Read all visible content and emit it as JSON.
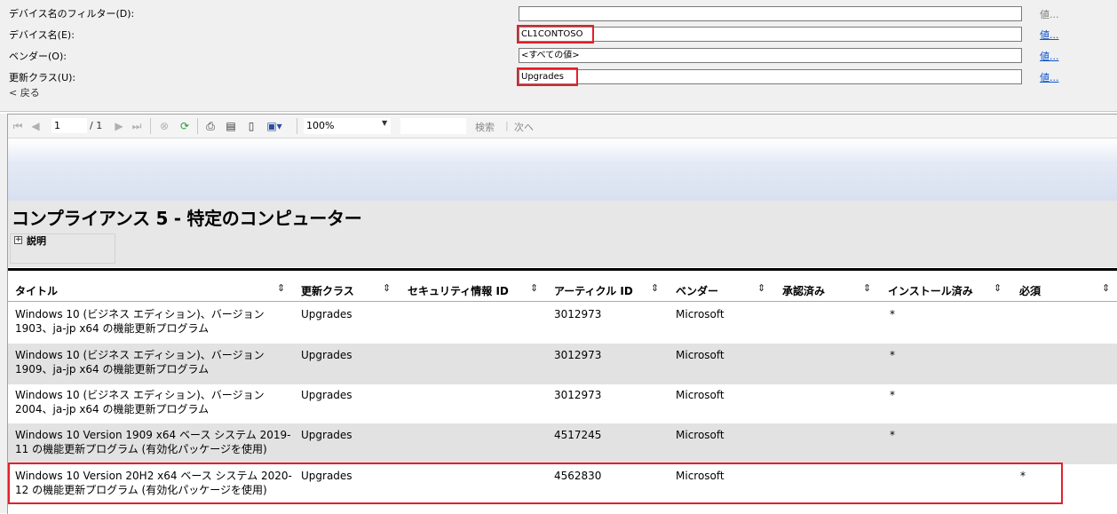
{
  "parameters": {
    "device_filter": {
      "label": "デバイス名のフィルター(D):",
      "value": "",
      "link": "値..."
    },
    "device_name": {
      "label": "デバイス名(E):",
      "value": "CL1CONTOSO",
      "link": "値..."
    },
    "vendor": {
      "label": "ベンダー(O):",
      "value": "<すべての値>",
      "link": "値..."
    },
    "update_class": {
      "label": "更新クラス(U):",
      "value": "Upgrades",
      "link": "値..."
    },
    "back": "< 戻る"
  },
  "toolbar": {
    "page_current": "1",
    "page_total": "/ 1",
    "zoom": "100%",
    "find": "検索",
    "separator": "|",
    "next": "次へ",
    "icons": [
      "first-page-icon",
      "prev-page-icon",
      "next-page-icon",
      "last-page-icon",
      "stop-icon",
      "refresh-icon",
      "print-icon",
      "print-layout-icon",
      "page-setup-icon",
      "export-icon"
    ]
  },
  "report": {
    "title": "コンプライアンス 5 - 特定のコンピューター",
    "description_label": "説明",
    "expand_glyph": "+"
  },
  "table": {
    "sort_glyph": "⇕",
    "columns": [
      "タイトル",
      "更新クラス",
      "セキュリティ情報 ID",
      "アーティクル ID",
      "ベンダー",
      "承認済み",
      "インストール済み",
      "必須"
    ],
    "rows": [
      {
        "title_line1": "Windows 10 (ビジネス エディション)、バージョン",
        "title_line2": "1903、ja-jp x64 の機能更新プログラム",
        "class": "Upgrades",
        "bulletin": "",
        "article": "3012973",
        "vendor": "Microsoft",
        "approved": "",
        "installed": "*",
        "required": ""
      },
      {
        "title_line1": "Windows 10 (ビジネス エディション)、バージョン",
        "title_line2": "1909、ja-jp x64 の機能更新プログラム",
        "class": "Upgrades",
        "bulletin": "",
        "article": "3012973",
        "vendor": "Microsoft",
        "approved": "",
        "installed": "*",
        "required": ""
      },
      {
        "title_line1": "Windows 10 (ビジネス エディション)、バージョン",
        "title_line2": "2004、ja-jp x64 の機能更新プログラム",
        "class": "Upgrades",
        "bulletin": "",
        "article": "3012973",
        "vendor": "Microsoft",
        "approved": "",
        "installed": "*",
        "required": ""
      },
      {
        "title_line1": "Windows 10 Version 1909 x64 ベース システム 2019-",
        "title_line2": "11 の機能更新プログラム (有効化パッケージを使用)",
        "class": "Upgrades",
        "bulletin": "",
        "article": "4517245",
        "vendor": "Microsoft",
        "approved": "",
        "installed": "*",
        "required": ""
      },
      {
        "title_line1": "Windows 10 Version 20H2 x64 ベース システム 2020-",
        "title_line2": "12 の機能更新プログラム (有効化パッケージを使用)",
        "class": "Upgrades",
        "bulletin": "",
        "article": "4562830",
        "vendor": "Microsoft",
        "approved": "",
        "installed": "",
        "required": "*"
      }
    ]
  },
  "colors": {
    "highlight": "#e3202a",
    "link": "#1155cc",
    "alt_row": "#e2e2e2"
  }
}
